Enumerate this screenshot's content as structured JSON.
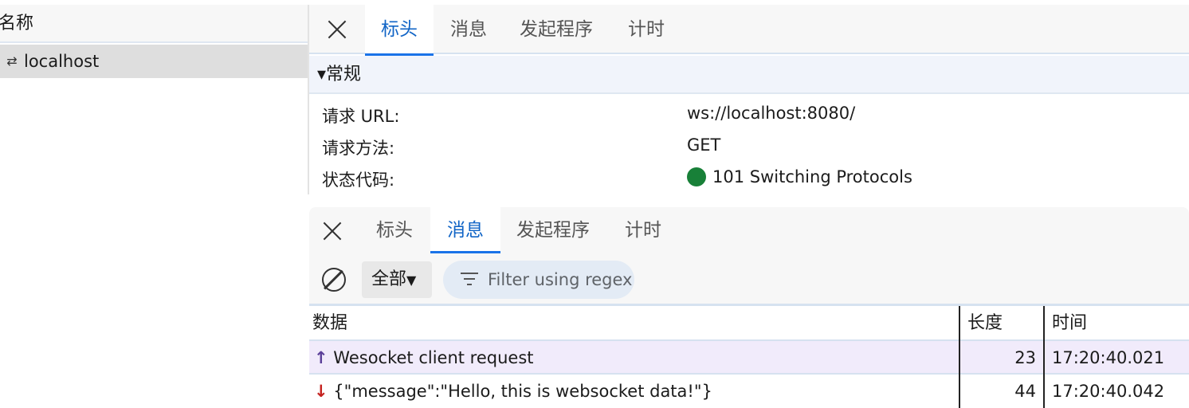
{
  "request_list": {
    "header": "名称",
    "items": [
      {
        "name": "localhost",
        "icon": "websocket-arrows-icon"
      }
    ]
  },
  "headers_panel": {
    "tabs": [
      "标头",
      "消息",
      "发起程序",
      "计时"
    ],
    "active_tab": "标头",
    "section_title": "▾常规",
    "fields": [
      {
        "key": "请求 URL:",
        "value": "ws://localhost:8080/"
      },
      {
        "key": "请求方法:",
        "value": "GET"
      },
      {
        "key": "状态代码:",
        "value": "101 Switching Protocols",
        "status_color": "#188038"
      }
    ]
  },
  "messages_panel": {
    "tabs": [
      "标头",
      "消息",
      "发起程序",
      "计时"
    ],
    "active_tab": "消息",
    "filter_select": "全部",
    "filter_placeholder": "Filter using regex",
    "columns": [
      "数据",
      "长度",
      "时间"
    ],
    "rows": [
      {
        "direction": "sent",
        "arrow": "↑",
        "data": "Wesocket client request",
        "length": "23",
        "time": "17:20:40.021"
      },
      {
        "direction": "received",
        "arrow": "↓",
        "data": "{\"message\":\"Hello, this is websocket data!\"}",
        "length": "44",
        "time": "17:20:40.042"
      }
    ]
  },
  "colors": {
    "accent": "#1a73e8",
    "sent_row_bg": "#f1ebfb",
    "status_ok": "#188038"
  }
}
